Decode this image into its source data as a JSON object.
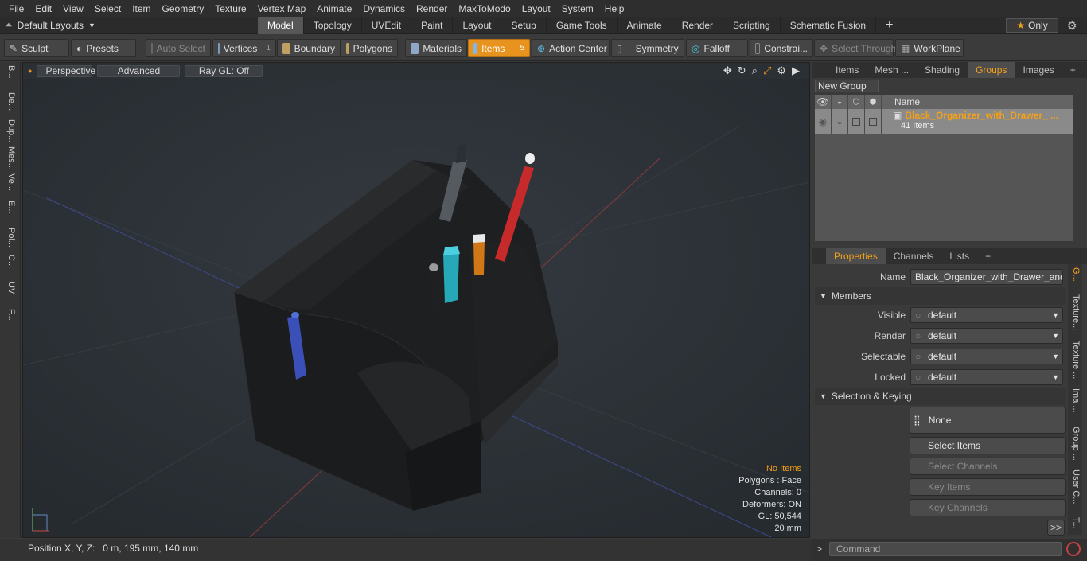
{
  "menu": [
    "File",
    "Edit",
    "View",
    "Select",
    "Item",
    "Geometry",
    "Texture",
    "Vertex Map",
    "Animate",
    "Dynamics",
    "Render",
    "MaxToModo",
    "Layout",
    "System",
    "Help"
  ],
  "layouts_label": "Default Layouts",
  "mode_tabs": [
    "Model",
    "Topology",
    "UVEdit",
    "Paint",
    "Layout",
    "Setup",
    "Game Tools",
    "Animate",
    "Render",
    "Scripting",
    "Schematic Fusion"
  ],
  "active_mode_tab": "Model",
  "only_label": "Only",
  "toolbar": {
    "sculpt": "Sculpt",
    "presets": "Presets",
    "auto_select": "Auto Select",
    "vertices": "Vertices",
    "vertices_count": "1",
    "boundary": "Boundary",
    "polygons": "Polygons",
    "materials": "Materials",
    "items": "Items",
    "items_count": "5",
    "action_center": "Action Center",
    "symmetry": "Symmetry",
    "falloff": "Falloff",
    "constraints": "Constrai...",
    "select_through": "Select Through",
    "workplane": "WorkPlane"
  },
  "left_tabs": [
    "B...",
    "De...",
    "Dup...",
    "Mes...",
    "Ve...",
    "E...",
    "Pol...",
    "C...",
    "UV",
    "F..."
  ],
  "viewport": {
    "view_mode": "Perspective",
    "shading": "Advanced",
    "raygl": "Ray GL: Off",
    "info": {
      "items": "No Items",
      "polygons": "Polygons : Face",
      "channels": "Channels: 0",
      "deformers": "Deformers: ON",
      "gl": "GL: 50,544",
      "scale": "20 mm"
    }
  },
  "status": {
    "position": "Position X, Y, Z:   0 m, 195 mm, 140 mm"
  },
  "right_top_tabs": [
    "Items",
    "Mesh ...",
    "Shading",
    "Groups",
    "Images"
  ],
  "right_top_active": "Groups",
  "groups": {
    "new_group": "New Group",
    "name_header": "Name",
    "rows": [
      {
        "name": "Black_Organizer_with_Drawer_ ...",
        "count": "41 Items"
      }
    ]
  },
  "prop_tabs": [
    "Properties",
    "Channels",
    "Lists"
  ],
  "prop_active": "Properties",
  "properties": {
    "name_label": "Name",
    "name_value": "Black_Organizer_with_Drawer_and_P",
    "members_section": "Members",
    "visible_label": "Visible",
    "visible_value": "default",
    "render_label": "Render",
    "render_value": "default",
    "selectable_label": "Selectable",
    "selectable_value": "default",
    "locked_label": "Locked",
    "locked_value": "default",
    "selkey_section": "Selection & Keying",
    "none_label": "None",
    "select_items": "Select Items",
    "select_channels": "Select Channels",
    "key_items": "Key Items",
    "key_channels": "Key Channels",
    "more": ">>"
  },
  "right_vert_tabs": [
    "G...",
    "Texture...",
    "Texture ...",
    "Ima ...",
    "Group ...",
    "User C...",
    "T..."
  ],
  "command_placeholder": "Command"
}
